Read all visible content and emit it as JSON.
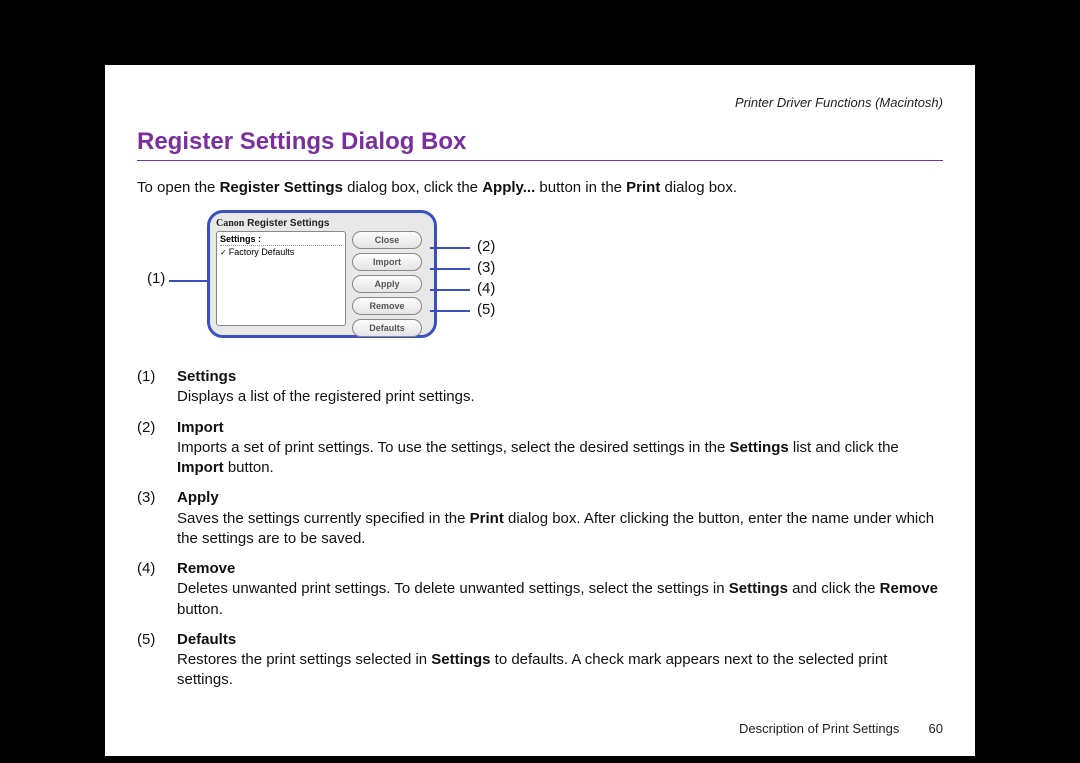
{
  "header": {
    "right": "Printer Driver Functions (Macintosh)"
  },
  "title": "Register Settings Dialog Box",
  "intro": {
    "pre": "To open the ",
    "b1": "Register Settings",
    "mid1": " dialog box, click the ",
    "b2": "Apply...",
    "mid2": " button in the ",
    "b3": "Print",
    "post": " dialog box."
  },
  "dialog": {
    "brand": "Canon",
    "title": "Register Settings",
    "settings_label": "Settings :",
    "default_item": "Factory Defaults",
    "buttons": {
      "close": "Close",
      "import": "Import",
      "apply": "Apply",
      "remove": "Remove",
      "defaults": "Defaults"
    }
  },
  "callouts": {
    "n1": "(1)",
    "n2": "(2)",
    "n3": "(3)",
    "n4": "(4)",
    "n5": "(5)"
  },
  "items": [
    {
      "num": "(1)",
      "name": "Settings",
      "parts": [
        {
          "t": "Displays a list of the registered print settings."
        }
      ]
    },
    {
      "num": "(2)",
      "name": "Import",
      "parts": [
        {
          "t": "Imports a set of print settings. To use the settings, select the desired settings in the "
        },
        {
          "b": "Settings"
        },
        {
          "t": " list and click the "
        },
        {
          "b": "Import"
        },
        {
          "t": " button."
        }
      ]
    },
    {
      "num": "(3)",
      "name": "Apply",
      "parts": [
        {
          "t": "Saves the settings currently specified in the "
        },
        {
          "b": "Print"
        },
        {
          "t": " dialog box. After clicking the button, enter the name under which the settings are to be saved."
        }
      ]
    },
    {
      "num": "(4)",
      "name": "Remove",
      "parts": [
        {
          "t": "Deletes unwanted print settings. To delete unwanted settings, select the settings in "
        },
        {
          "b": "Settings"
        },
        {
          "t": " and click the "
        },
        {
          "b": "Remove"
        },
        {
          "t": " button."
        }
      ]
    },
    {
      "num": "(5)",
      "name": "Defaults",
      "parts": [
        {
          "t": "Restores the print settings selected in "
        },
        {
          "b": "Settings"
        },
        {
          "t": " to defaults. A check mark appears next to the selected print settings."
        }
      ]
    }
  ],
  "footer": {
    "text": "Description of Print Settings",
    "page": "60"
  }
}
